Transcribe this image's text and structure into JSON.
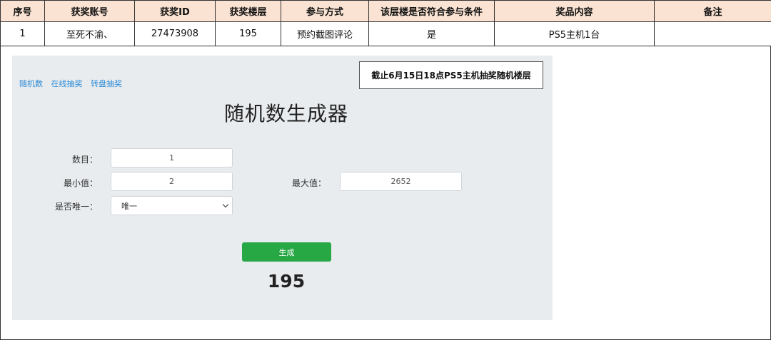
{
  "table": {
    "headers": [
      "序号",
      "获奖账号",
      "获奖ID",
      "获奖楼层",
      "参与方式",
      "该层楼是否符合参与条件",
      "奖品内容",
      "备注"
    ],
    "row": [
      "1",
      "至死不渝、",
      "27473908",
      "195",
      "预约截图评论",
      "是",
      "PS5主机1台",
      ""
    ]
  },
  "generator": {
    "nav_links": [
      "随机数",
      "在线抽奖",
      "转盘抽奖"
    ],
    "notice": "截止6月15日18点PS5主机抽奖随机楼层",
    "title": "随机数生成器",
    "count_label": "数目：",
    "count_value": "1",
    "min_label": "最小值：",
    "min_value": "2",
    "max_label": "最大值：",
    "max_value": "2652",
    "unique_label": "是否唯一：",
    "unique_value": "唯一",
    "generate_label": "生成",
    "result": "195"
  }
}
